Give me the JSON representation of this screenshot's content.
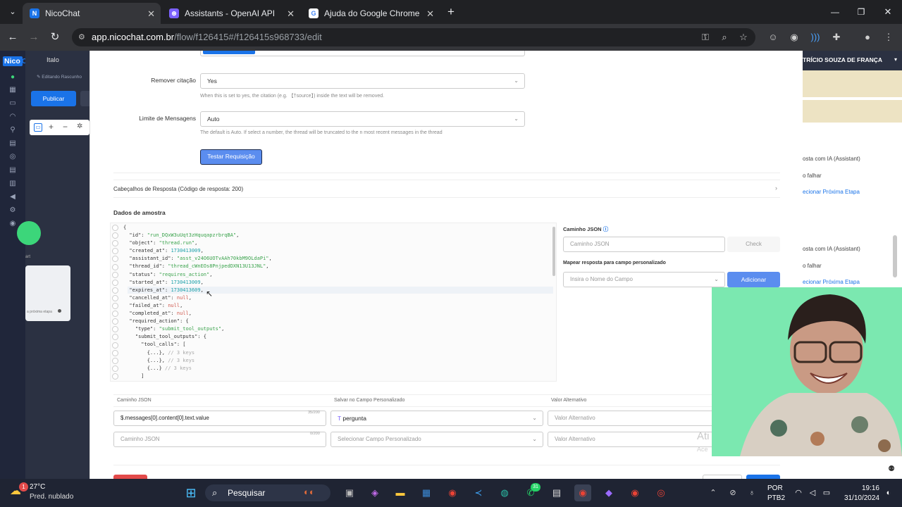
{
  "browser": {
    "tabs": [
      {
        "title": "NicoChat",
        "favicon": "N"
      },
      {
        "title": "Assistants - OpenAI API",
        "favicon": "⊛"
      },
      {
        "title": "Ajuda do Google Chrome",
        "favicon": "G"
      }
    ],
    "url_host": "app.nicochat.com.br",
    "url_path": "/flow/f126415#/f126415s968733/edit"
  },
  "app": {
    "brand_a": "Nico",
    "brand_b": "Chat",
    "user": "Italo",
    "draft_label": "Editando Rascunho",
    "publish_label": "Publicar",
    "right_header": "TRÍCIO SOUZA DE FRANÇA",
    "right_items": [
      "osta com IA (Assistant)",
      "o falhar",
      "ecionar Próxima Etapa",
      "osta com IA (Assistant)",
      "o falhar",
      "ecionar Próxima Etapa"
    ],
    "left_node": "a próxima etapa",
    "left_start": "art"
  },
  "form": {
    "remove_citation_label": "Remover citação",
    "remove_citation_value": "Yes",
    "remove_citation_hint": "When this is set to yes, the citation (e.g. 【†source】) inside the text will be removed.",
    "limit_label": "Limite de Mensagens",
    "limit_value": "Auto",
    "limit_hint": "The default is Auto. If select a number, the thread will be truncated to the n most recent messages in the thread",
    "test_button": "Testar Requisição",
    "headers_label": "Cabeçalhos de Resposta (Código de resposta: 200)",
    "sample_title": "Dados de amostra",
    "json_path_title": "Caminho JSON",
    "json_path_placeholder": "Caminho JSON",
    "check_label": "Check",
    "map_title": "Mapear resposta para campo personalizado",
    "field_placeholder": "Insira o Nome do Campo",
    "add_button": "Adicionar"
  },
  "json_lines": [
    [
      [
        "k",
        "{"
      ]
    ],
    [
      [
        "k",
        "  \"id\": "
      ],
      [
        "s",
        "\"run_DQxW3uUqt3zHquqapzrbrqBA\""
      ],
      [
        "k",
        ","
      ]
    ],
    [
      [
        "k",
        "  \"object\": "
      ],
      [
        "s",
        "\"thread.run\""
      ],
      [
        "k",
        ","
      ]
    ],
    [
      [
        "k",
        "  \"created_at\": "
      ],
      [
        "n",
        "1730413009"
      ],
      [
        "k",
        ","
      ]
    ],
    [
      [
        "k",
        "  \"assistant_id\": "
      ],
      [
        "s",
        "\"asst_v24O6UOTvAAh70kbM9OLdaPi\""
      ],
      [
        "k",
        ","
      ]
    ],
    [
      [
        "k",
        "  \"thread_id\": "
      ],
      [
        "s",
        "\"thread_cWnEOs8PnjpedDXN13U13JNL\""
      ],
      [
        "k",
        ","
      ]
    ],
    [
      [
        "k",
        "  \"status\": "
      ],
      [
        "s",
        "\"requires_action\""
      ],
      [
        "k",
        ","
      ]
    ],
    [
      [
        "k",
        "  \"started_at\": "
      ],
      [
        "n",
        "1730413009"
      ],
      [
        "k",
        ","
      ]
    ],
    [
      [
        "k",
        "  \"expires_at\": "
      ],
      [
        "n",
        "1730413609"
      ],
      [
        "k",
        ","
      ]
    ],
    [
      [
        "k",
        "  \"cancelled_at\": "
      ],
      [
        "nl",
        "null"
      ],
      [
        "k",
        ","
      ]
    ],
    [
      [
        "k",
        "  \"failed_at\": "
      ],
      [
        "nl",
        "null"
      ],
      [
        "k",
        ","
      ]
    ],
    [
      [
        "k",
        "  \"completed_at\": "
      ],
      [
        "nl",
        "null"
      ],
      [
        "k",
        ","
      ]
    ],
    [
      [
        "k",
        "  \"required_action\": {"
      ]
    ],
    [
      [
        "k",
        "    \"type\": "
      ],
      [
        "s",
        "\"submit_tool_outputs\""
      ],
      [
        "k",
        ","
      ]
    ],
    [
      [
        "k",
        "    \"submit_tool_outputs\": {"
      ]
    ],
    [
      [
        "k",
        "      \"tool_calls\": ["
      ]
    ],
    [
      [
        "k",
        "        {...}, "
      ],
      [
        "c",
        "// 3 keys"
      ]
    ],
    [
      [
        "k",
        "        {...}, "
      ],
      [
        "c",
        "// 3 keys"
      ]
    ],
    [
      [
        "k",
        "        {...} "
      ],
      [
        "c",
        "// 3 keys"
      ]
    ],
    [
      [
        "k",
        "      ]"
      ]
    ]
  ],
  "mapping": {
    "headers": [
      "Caminho JSON",
      "Salvar no Campo Personalizado",
      "Valor Alternativo"
    ],
    "rows": [
      {
        "path": "$.messages[0].content[0].text.value",
        "count": "35/200",
        "field": "pergunta",
        "alt": "Valor Alternativo"
      },
      {
        "path": "Caminho JSON",
        "count": "0/200",
        "field": "Selecionar Campo Personalizado",
        "alt": "Valor Alternativo"
      }
    ]
  },
  "watermark": {
    "line1": "Ati",
    "line2": "Ace"
  },
  "taskbar": {
    "weather_temp": "27°C",
    "weather_desc": "Pred. nublado",
    "weather_badge": "1",
    "search_label": "Pesquisar",
    "lang1": "POR",
    "lang2": "PTB2",
    "time": "19:16",
    "date": "31/10/2024",
    "badge_whatsapp": "31"
  }
}
